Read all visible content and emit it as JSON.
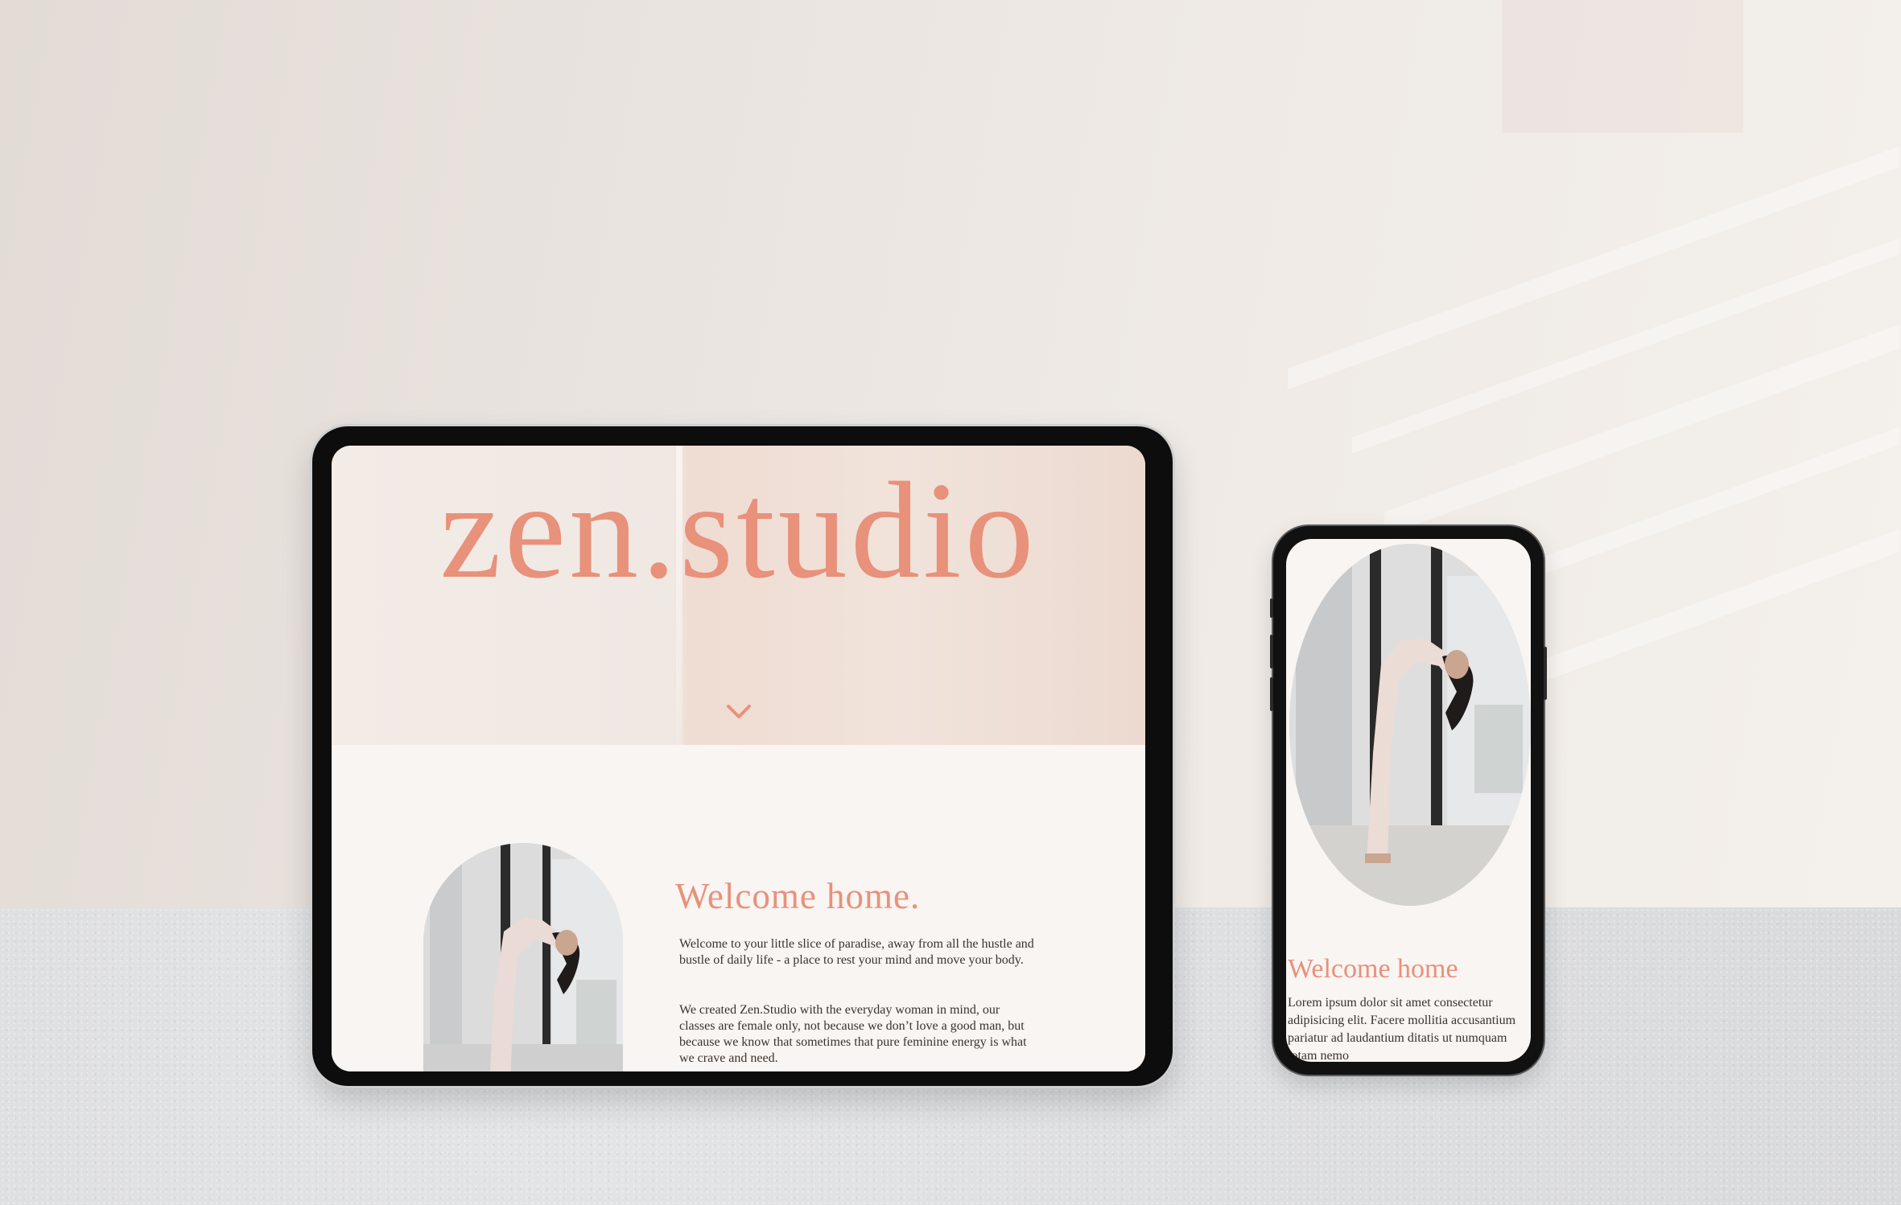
{
  "tablet": {
    "brand": "zen.studio",
    "welcome_title": "Welcome home.",
    "paragraph_1": "Welcome to your little slice of paradise, away from all the hustle and bustle of daily life - a place to rest your mind and move your body.",
    "paragraph_2": "We created Zen.Studio with the everyday woman in mind, our classes are female only, not because we don’t love a good man, but because we know that sometimes that pure feminine energy is what we crave and need."
  },
  "phone": {
    "welcome_title": "Welcome home",
    "paragraph": "Lorem ipsum dolor sit amet consectetur adipisicing elit. Facere mollitia accusantium pariatur ad laudantium ditatis ut numquam totam nemo"
  },
  "colors": {
    "accent": "#e8917b",
    "body_text": "#3a3330",
    "screen_bg": "#f8f5f2"
  },
  "icons": [
    "chevron-down-icon"
  ]
}
